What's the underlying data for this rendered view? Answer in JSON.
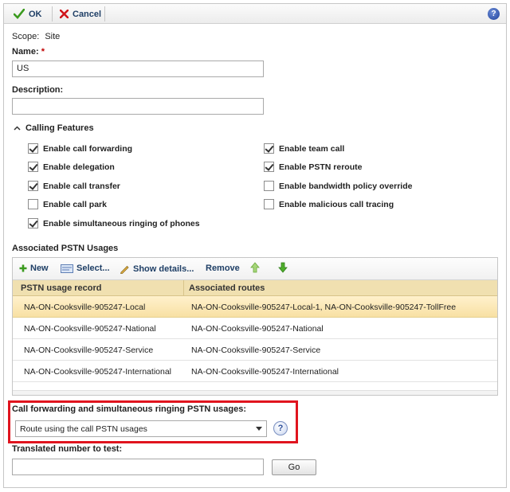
{
  "toolbar": {
    "ok_label": "OK",
    "cancel_label": "Cancel",
    "help_icon": "help-icon"
  },
  "form": {
    "scope_label": "Scope:",
    "scope_value": "Site",
    "name_label": "Name:",
    "name_required": "*",
    "name_value": "US",
    "description_label": "Description:",
    "description_value": ""
  },
  "calling_features": {
    "title": "Calling Features",
    "options": [
      {
        "label": "Enable call forwarding",
        "checked": true
      },
      {
        "label": "Enable delegation",
        "checked": true
      },
      {
        "label": "Enable call transfer",
        "checked": true
      },
      {
        "label": "Enable call park",
        "checked": false
      },
      {
        "label": "Enable simultaneous ringing of phones",
        "checked": true
      },
      {
        "label": "Enable team call",
        "checked": true
      },
      {
        "label": "Enable PSTN reroute",
        "checked": true
      },
      {
        "label": "Enable bandwidth policy override",
        "checked": false
      },
      {
        "label": "Enable malicious call tracing",
        "checked": false
      }
    ]
  },
  "pstn": {
    "section_label": "Associated PSTN Usages",
    "toolbar": {
      "new_label": "New",
      "select_label": "Select...",
      "show_details_label": "Show details...",
      "remove_label": "Remove"
    },
    "columns": [
      "PSTN usage record",
      "Associated routes"
    ],
    "rows": [
      {
        "record": "NA-ON-Cooksville-905247-Local",
        "routes": "NA-ON-Cooksville-905247-Local-1, NA-ON-Cooksville-905247-TollFree",
        "selected": true
      },
      {
        "record": "NA-ON-Cooksville-905247-National",
        "routes": "NA-ON-Cooksville-905247-National",
        "selected": false
      },
      {
        "record": "NA-ON-Cooksville-905247-Service",
        "routes": "NA-ON-Cooksville-905247-Service",
        "selected": false
      },
      {
        "record": "NA-ON-Cooksville-905247-International",
        "routes": "NA-ON-Cooksville-905247-International",
        "selected": false
      }
    ]
  },
  "forwarding": {
    "label": "Call forwarding and simultaneous ringing PSTN usages:",
    "selected_value": "Route using the call PSTN usages",
    "help_glyph": "?"
  },
  "test": {
    "label": "Translated number to test:",
    "value": "",
    "go_label": "Go"
  },
  "colors": {
    "highlight_border": "#e0141e",
    "selected_row": "#f8e0a4",
    "header_row": "#f0e0b0",
    "button_text": "#1f3f66"
  }
}
